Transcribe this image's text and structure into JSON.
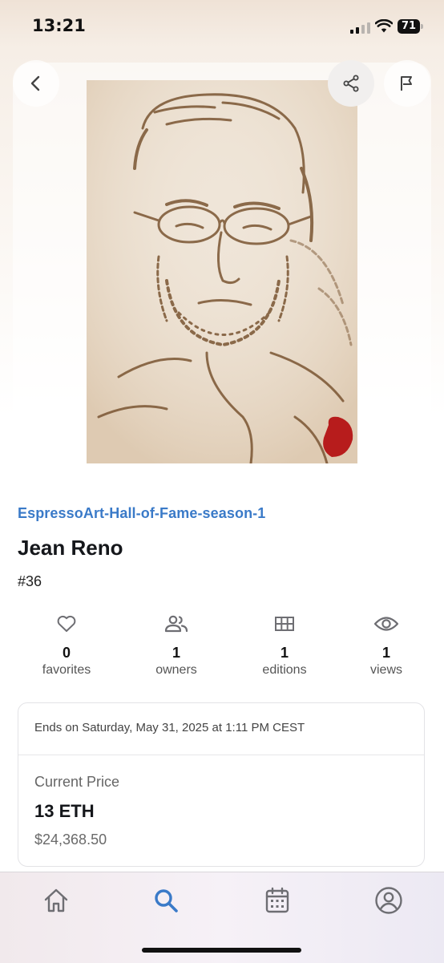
{
  "status_bar": {
    "time": "13:21",
    "battery": "71"
  },
  "artwork": {
    "alt": "Espresso portrait of Jean Reno"
  },
  "nft": {
    "collection": "EspressoArt-Hall-of-Fame-season-1",
    "title": "Jean Reno",
    "token_id": "#36"
  },
  "stats": [
    {
      "icon": "heart-icon",
      "value": "0",
      "label": "favorites"
    },
    {
      "icon": "owners-icon",
      "value": "1",
      "label": "owners"
    },
    {
      "icon": "editions-grid-icon",
      "value": "1",
      "label": "editions"
    },
    {
      "icon": "eye-icon",
      "value": "1",
      "label": "views"
    }
  ],
  "auction": {
    "ends_text": "Ends on Saturday, May 31, 2025 at 1:11 PM CEST",
    "current_price_label": "Current Price",
    "price_eth": "13 ETH",
    "price_usd": "$24,368.50"
  },
  "tabs": [
    {
      "name": "home",
      "icon": "home-icon",
      "active": false
    },
    {
      "name": "search",
      "icon": "search-icon",
      "active": true
    },
    {
      "name": "calendar",
      "icon": "calendar-icon",
      "active": false
    },
    {
      "name": "profile",
      "icon": "profile-icon",
      "active": false
    }
  ],
  "colors": {
    "accent": "#3a7ac8",
    "icon_gray": "#6e6e73",
    "text": "#14161a"
  }
}
